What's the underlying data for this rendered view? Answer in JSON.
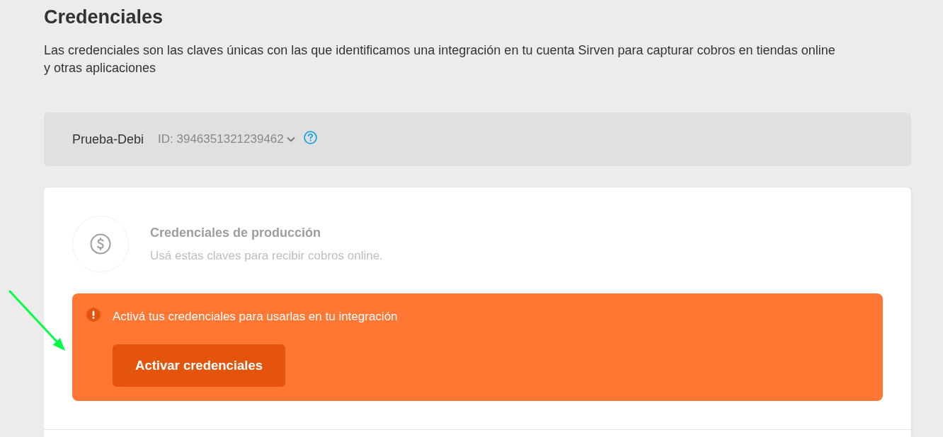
{
  "page": {
    "title": "Credenciales",
    "description": "Las credenciales son las claves únicas con las que identificamos una integración en tu cuenta Sirven para capturar cobros en tiendas online y otras aplicaciones"
  },
  "account": {
    "name": "Prueba-Debi",
    "id": "ID: 3946351321239462",
    "expanded": false
  },
  "credentials_card": {
    "title": "Credenciales de producción",
    "subtitle": "Usá estas claves para recibir cobros online.",
    "disabled": true
  },
  "alert": {
    "kind": "warning",
    "message": "Activá tus credenciales para usarlas en tu integración",
    "button": "Activar credenciales"
  },
  "annotation": {
    "kind": "arrow"
  }
}
